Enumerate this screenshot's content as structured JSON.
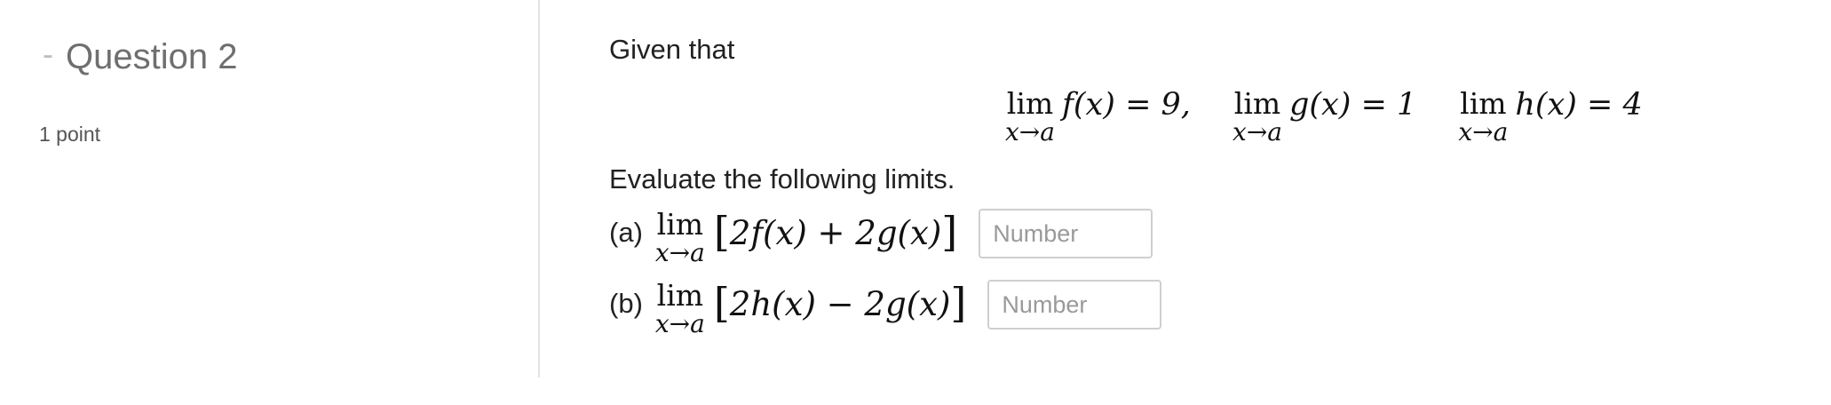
{
  "question": {
    "dash": "-",
    "title": "Question 2",
    "points": "1 point"
  },
  "problem": {
    "intro": "Given that",
    "given": [
      {
        "lim": "lim",
        "sub": "x→a",
        "expr": "f(x) = 9,"
      },
      {
        "lim": "lim",
        "sub": "x→a",
        "expr": "g(x) = 1"
      },
      {
        "lim": "lim",
        "sub": "x→a",
        "expr": "h(x) = 4"
      }
    ],
    "instruction": "Evaluate the following limits.",
    "parts": [
      {
        "label": "(a)",
        "lim": "lim",
        "sub": "x→a",
        "expr": "2f(x) + 2g(x)",
        "input_value": "",
        "placeholder": "Number"
      },
      {
        "label": "(b)",
        "lim": "lim",
        "sub": "x→a",
        "expr": "2h(x) − 2g(x)",
        "input_value": "",
        "placeholder": "Number"
      }
    ]
  }
}
